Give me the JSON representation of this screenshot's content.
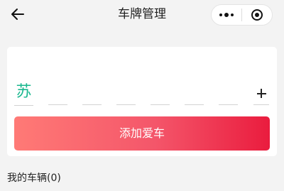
{
  "nav": {
    "title": "车牌管理",
    "back_icon": "arrow-left-icon",
    "more_icon": "more-dots-icon",
    "close_icon": "target-circle-icon"
  },
  "plate_input": {
    "province": "苏",
    "province_color": "#19b78e",
    "slots": [
      "",
      "",
      "",
      "",
      "",
      ""
    ],
    "expand_icon": "plus-icon"
  },
  "actions": {
    "add_car_label": "添加爱车",
    "gradient_start": "#ff7a76",
    "gradient_end": "#ea1c3e"
  },
  "my_cars": {
    "title": "我的车辆(0)"
  }
}
